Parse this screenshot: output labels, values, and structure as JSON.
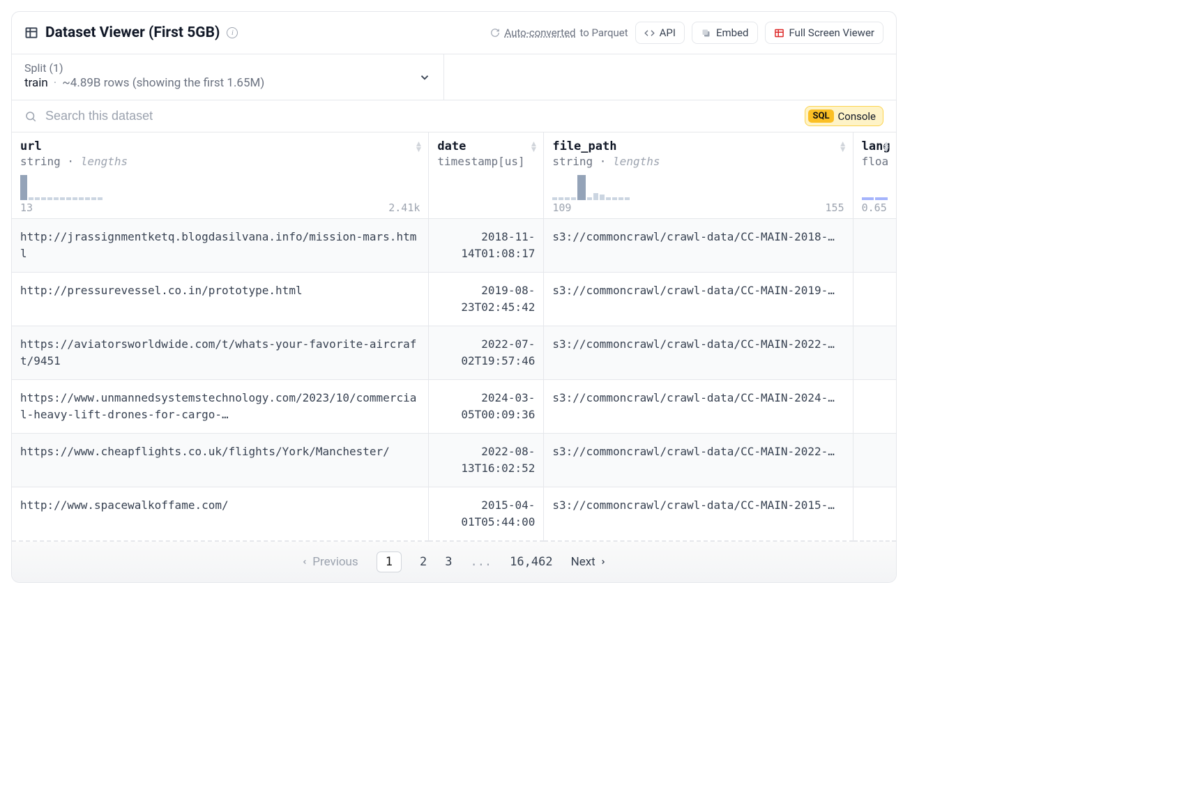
{
  "header": {
    "title": "Dataset Viewer (First 5GB)",
    "auto_convert_link": "Auto-converted",
    "auto_convert_suffix": " to Parquet",
    "api_label": "API",
    "embed_label": "Embed",
    "fullscreen_label": "Full Screen Viewer"
  },
  "split": {
    "label": "Split (1)",
    "name": "train",
    "separator": "·",
    "count": "~4.89B rows (showing the first 1.65M)"
  },
  "search": {
    "placeholder": "Search this dataset",
    "sql_badge": "SQL",
    "console_label": "Console"
  },
  "columns": [
    {
      "name": "url",
      "type": "string",
      "hint": "lengths",
      "histo_min": "13",
      "histo_max": "2.41k",
      "width": "580"
    },
    {
      "name": "date",
      "type": "timestamp[us]",
      "hint": "",
      "histo_min": "",
      "histo_max": "",
      "width": "160"
    },
    {
      "name": "file_path",
      "type": "string",
      "hint": "lengths",
      "histo_min": "109",
      "histo_max": "155",
      "width": "430"
    },
    {
      "name": "lang",
      "type": "floa",
      "hint": "",
      "histo_min": "0.65",
      "histo_max": "",
      "width": "60"
    }
  ],
  "rows": [
    {
      "url": "http://jrassignmentketq.blogdasilvana.info/mission-mars.html",
      "date": "2018-11-14T01:08:17",
      "file_path": "s3://commoncrawl/crawl-data/CC-MAIN-2018-…",
      "lang": ""
    },
    {
      "url": "http://pressurevessel.co.in/prototype.html",
      "date": "2019-08-23T02:45:42",
      "file_path": "s3://commoncrawl/crawl-data/CC-MAIN-2019-…",
      "lang": ""
    },
    {
      "url": "https://aviatorsworldwide.com/t/whats-your-favorite-aircraft/9451",
      "date": "2022-07-02T19:57:46",
      "file_path": "s3://commoncrawl/crawl-data/CC-MAIN-2022-…",
      "lang": ""
    },
    {
      "url": "https://www.unmannedsystemstechnology.com/2023/10/commercial-heavy-lift-drones-for-cargo-…",
      "date": "2024-03-05T00:09:36",
      "file_path": "s3://commoncrawl/crawl-data/CC-MAIN-2024-…",
      "lang": ""
    },
    {
      "url": "https://www.cheapflights.co.uk/flights/York/Manchester/",
      "date": "2022-08-13T16:02:52",
      "file_path": "s3://commoncrawl/crawl-data/CC-MAIN-2022-…",
      "lang": ""
    },
    {
      "url": "http://www.spacewalkoffame.com/",
      "date": "2015-04-01T05:44:00",
      "file_path": "s3://commoncrawl/crawl-data/CC-MAIN-2015-…",
      "lang": ""
    }
  ],
  "pagination": {
    "previous": "Previous",
    "pages": [
      "1",
      "2",
      "3",
      "...",
      "16,462"
    ],
    "current": "1",
    "next": "Next"
  }
}
